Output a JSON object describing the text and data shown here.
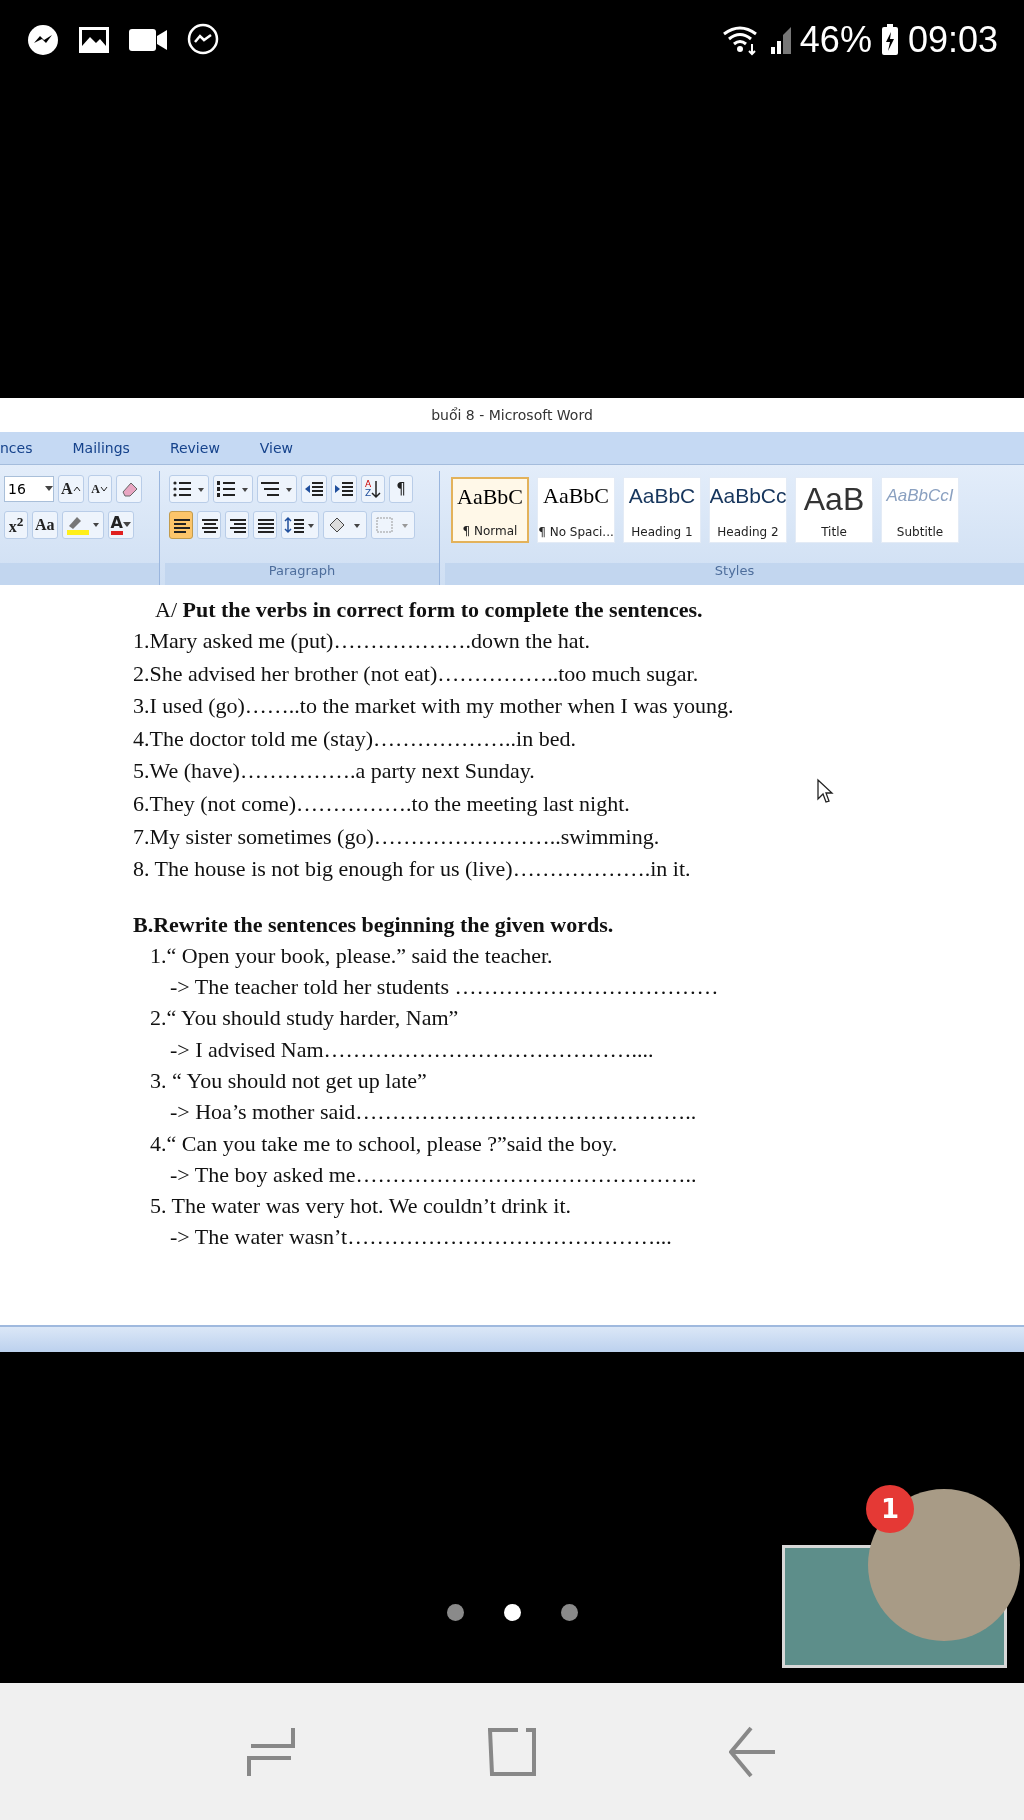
{
  "status_bar": {
    "battery": "46%",
    "time": "09:03"
  },
  "window": {
    "title": "buổi 8 - Microsoft Word"
  },
  "tabs": [
    {
      "label": "nces",
      "selected": false
    },
    {
      "label": "Mailings",
      "selected": false
    },
    {
      "label": "Review",
      "selected": false
    },
    {
      "label": "View",
      "selected": false
    }
  ],
  "ribbon": {
    "font_size": "16",
    "pilcrow": "¶",
    "grow_font": "A",
    "shrink_font": "A",
    "superscript": "x$^{2}$",
    "change_case": "Aa",
    "font_color": "A",
    "sort_letters": [
      "A",
      "Z"
    ],
    "alignment": [
      {
        "kind": "left",
        "selected": true
      },
      {
        "kind": "center",
        "selected": false
      },
      {
        "kind": "right",
        "selected": false
      },
      {
        "kind": "justify",
        "selected": false
      }
    ],
    "groups": [
      "Paragraph",
      "Styles"
    ],
    "styles": [
      {
        "kind": "normal",
        "preview": "AaBbC",
        "name": "¶ Normal",
        "selected": true
      },
      {
        "kind": "normal",
        "preview": "AaBbC",
        "name": "¶ No Spaci...",
        "selected": false
      },
      {
        "kind": "heading",
        "preview": "AaBbC",
        "name": "Heading 1",
        "selected": false
      },
      {
        "kind": "heading",
        "preview": "AaBbCc",
        "name": "Heading 2",
        "selected": false
      },
      {
        "kind": "title",
        "preview": "AaB",
        "name": "Title",
        "selected": false
      },
      {
        "kind": "subtitle",
        "preview": "AaBbCcI",
        "name": "Subtitle",
        "selected": false
      }
    ]
  },
  "document": {
    "section_a": {
      "heading": "A/ **Put the verbs in correct form to complete the sentences.**",
      "items": [
        "1.Mary asked me (put)……………….down  the hat.",
        "2.She advised her brother (not eat)……………..too  much sugar.",
        "3.I used (go)……..to the market with my mother when I was young.",
        "4.The doctor told me (stay)………………..in  bed.",
        "5.We (have)…………….a party next Sunday.",
        "6.They (not come)…………….to  the meeting last night.",
        "7.My sister sometimes  (go)……………………..swimming.",
        "8. The house is not big enough for us (live)……………….in  it."
      ]
    },
    "section_b": {
      "heading": "B.Rewrite the sentences beginning the given words.",
      "items": [
        {
          "prompt": "1.“ Open your book, please.” said the teacher.",
          "answer": "-> The teacher told her students ………………………………"
        },
        {
          "prompt": "2.“ You should study harder, Nam”",
          "answer": "-> I advised Nam……………………………………...."
        },
        {
          "prompt": "3.  “ You should not get up late”",
          "answer": "-> Hoa’s mother said……………………………………….."
        },
        {
          "prompt": "4.“ Can you take me to school, please ?”said the boy.",
          "answer": "-> The boy asked me……………………………………….."
        },
        {
          "prompt": "5.  The water was very hot. We couldn’t drink it.",
          "answer": "-> The water wasn’t……………………………………..."
        }
      ]
    }
  },
  "page_indicator": [
    {
      "selected": false
    },
    {
      "selected": true
    },
    {
      "selected": false
    }
  ],
  "chat_head": {
    "badge": "1"
  }
}
